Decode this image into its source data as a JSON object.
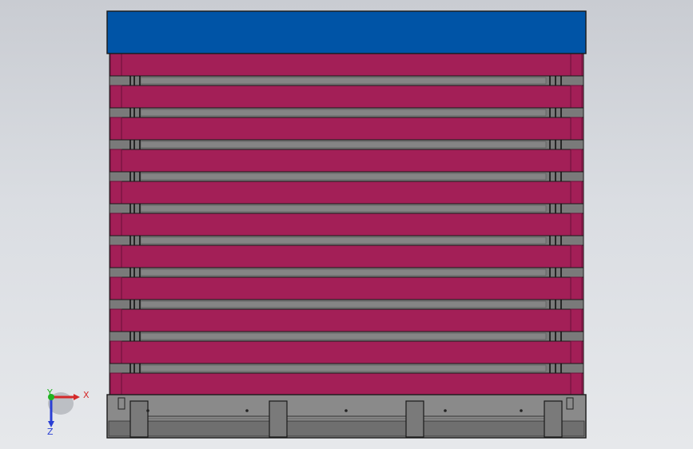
{
  "view": {
    "background_top": "#c9ccd2",
    "background_bottom": "#e6e8eb"
  },
  "assembly": {
    "top_cover_color": "#0054a6",
    "slat_color": "#a31f57",
    "slat_edge_color": "#6a1038",
    "gap_color": "#6b6b6b",
    "base_color": "#8a8a8a",
    "base_dark_color": "#6f6f6f",
    "outline_color": "#1a1a1a",
    "slat_count": 11,
    "support_leg_count": 4
  },
  "triad": {
    "x_label": "X",
    "y_label": "Y",
    "z_label": "Z",
    "x_color": "#d42a2a",
    "y_color": "#1fb31f",
    "z_color": "#2a3fd4"
  }
}
